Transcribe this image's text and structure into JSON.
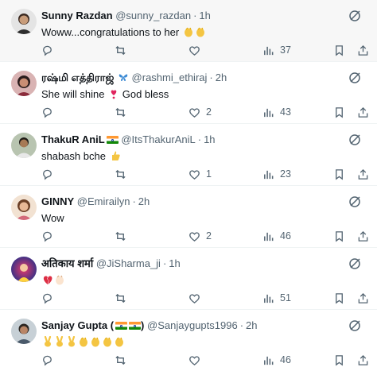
{
  "replies": [
    {
      "name": "Sunny Razdan",
      "handle": "@sunny_razdan",
      "time": "1h",
      "text": "Woww...congratulations to her",
      "emojis": [
        "clap",
        "clap"
      ],
      "replies_count": "",
      "reposts": "",
      "likes": "",
      "views": "37",
      "avatar_colors": [
        "#e6e6e6",
        "#c9c9c9"
      ]
    },
    {
      "name": "ரஷ்மி எத்திராஜ்",
      "name_emoji": "butterfly",
      "handle": "@rashmi_ethiraj",
      "time": "2h",
      "text": "She will shine",
      "text_after": "God bless",
      "emojis": [
        "heart-exclamation"
      ],
      "replies_count": "",
      "reposts": "",
      "likes": "2",
      "views": "43",
      "avatar_colors": [
        "#3a2a2a",
        "#d4a0a0"
      ]
    },
    {
      "name": "ThakuR AniL",
      "name_emoji": "flag-india",
      "handle": "@ItsThakurAniL",
      "time": "1h",
      "text": "shabash bche",
      "emojis": [
        "thumbs-up"
      ],
      "replies_count": "",
      "reposts": "",
      "likes": "1",
      "views": "23",
      "avatar_colors": [
        "#c9b7a0",
        "#6b5840"
      ]
    },
    {
      "name": "GINNY",
      "handle": "@Emirailyn",
      "time": "2h",
      "text": "Wow",
      "emojis": [],
      "replies_count": "",
      "reposts": "",
      "likes": "2",
      "views": "46",
      "avatar_colors": [
        "#f0d6c0",
        "#b88a6a"
      ]
    },
    {
      "name": "अतिकाय शर्मा",
      "handle": "@JiSharma_ji",
      "time": "1h",
      "text": "",
      "emojis": [
        "broken-heart",
        "clap"
      ],
      "replies_count": "",
      "reposts": "",
      "likes": "",
      "views": "51",
      "avatar_colors": [
        "#2a3a9a",
        "#e83a6a"
      ]
    },
    {
      "name": "Sanjay Gupta",
      "name_emoji": "flag-india-2",
      "handle": "@Sanjaygupts1996",
      "time": "2h",
      "text": "",
      "emojis": [
        "victory",
        "victory",
        "victory",
        "clap",
        "clap",
        "clap",
        "clap"
      ],
      "replies_count": "",
      "reposts": "",
      "likes": "",
      "views": "46",
      "avatar_colors": [
        "#9aa7b0",
        "#5a6570"
      ]
    }
  ],
  "icons": {
    "reply": "reply-icon",
    "repost": "repost-icon",
    "like": "like-icon",
    "views": "views-icon",
    "bookmark": "bookmark-icon",
    "share": "share-icon",
    "grok": "grok-icon"
  },
  "colors": {
    "text": "#0f1419",
    "muted": "#536471",
    "divider": "#eff3f4",
    "highlight_bg": "#f7f7f7"
  }
}
